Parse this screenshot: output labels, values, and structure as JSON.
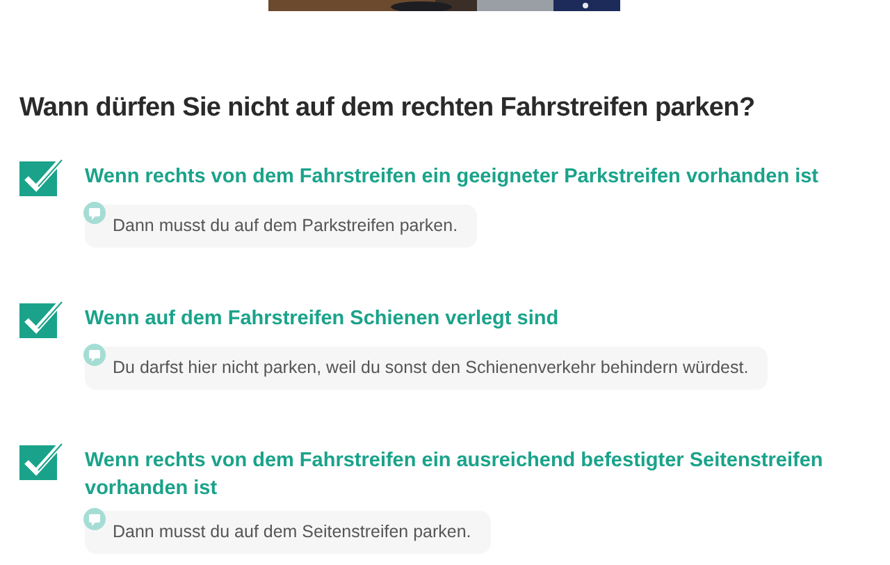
{
  "question": "Wann dürfen Sie nicht auf dem rechten Fahrstreifen parken?",
  "answers": [
    {
      "text": "Wenn rechts von dem Fahrstreifen ein geeigneter Parkstreifen vorhanden ist",
      "checked": true,
      "explanation": "Dann musst du auf dem Parkstreifen parken."
    },
    {
      "text": "Wenn auf dem Fahrstreifen Schienen verlegt sind",
      "checked": true,
      "explanation": "Du darfst hier nicht parken, weil du sonst den Schienenverkehr behindern würdest."
    },
    {
      "text": "Wenn rechts von dem Fahrstreifen ein ausreichend befestigter Seitenstreifen vorhanden ist",
      "checked": true,
      "explanation": "Dann musst du auf dem Seitenstreifen parken."
    }
  ]
}
